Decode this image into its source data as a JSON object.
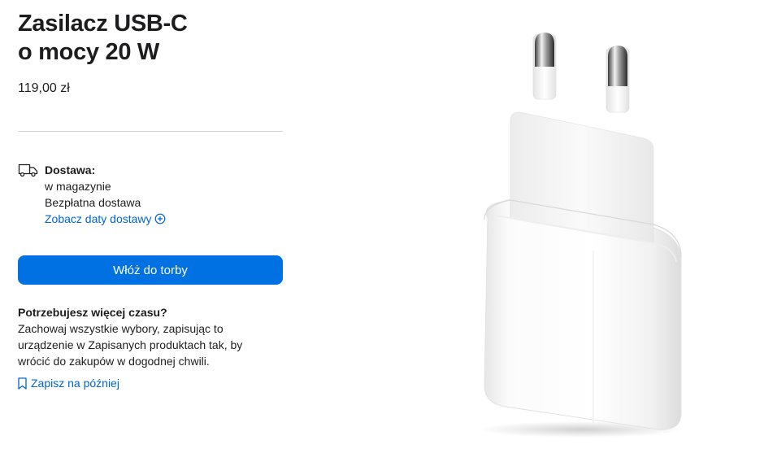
{
  "product": {
    "title_line1": "Zasilacz USB-C",
    "title_line2": "o mocy 20 W",
    "price": "119,00 zł",
    "image_icon": "usb-c-power-adapter-image"
  },
  "delivery": {
    "icon": "truck-icon",
    "title": "Dostawa:",
    "stock": "w magazynie",
    "shipping": "Bezpłatna dostawa",
    "dates_link": "Zobacz daty dostawy",
    "dates_icon": "plus-circle-icon"
  },
  "actions": {
    "add_to_bag": "Włóż do torby"
  },
  "save": {
    "heading": "Potrzebujesz więcej czasu?",
    "body": "Zachowaj wszystkie wybory, zapisując to urządzenie w Zapisanych produktach tak, by wrócić do zakupów w dogodnej chwili.",
    "link": "Zapisz na później",
    "link_icon": "bookmark-icon"
  },
  "colors": {
    "accent": "#0071e3",
    "link": "#0066cc",
    "text": "#1d1d1f",
    "divider": "#d2d2d7"
  }
}
